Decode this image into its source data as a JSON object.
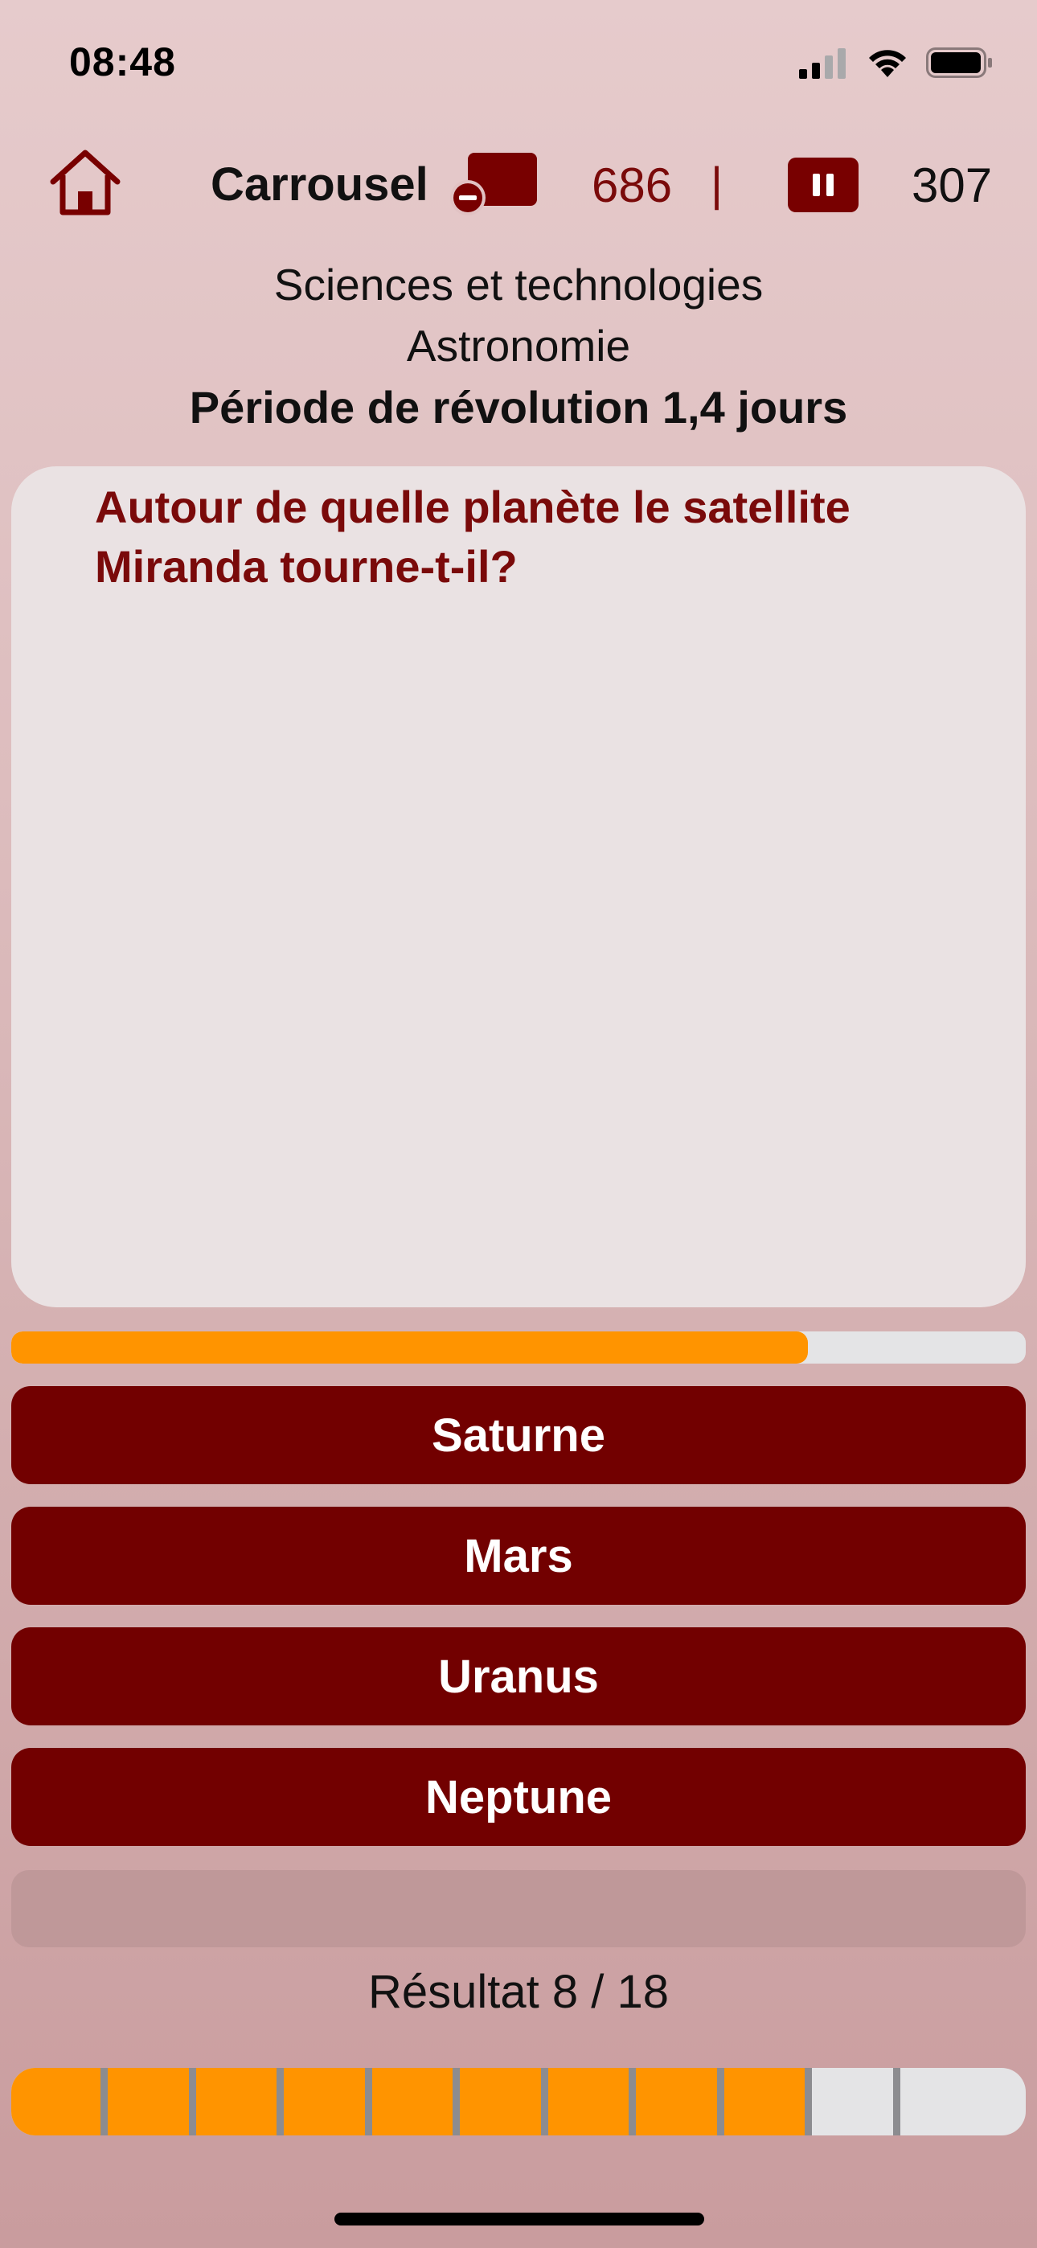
{
  "status_bar": {
    "time": "08:48",
    "icons": [
      "cellular-signal-icon",
      "wifi-icon",
      "battery-icon"
    ]
  },
  "header": {
    "home_icon": "home-icon",
    "mode_title": "Carrousel",
    "card_icon": "card-minus-icon",
    "score_left": "686",
    "separator": "|",
    "pause_icon": "pause-icon",
    "score_right": "307"
  },
  "category": {
    "domain": "Sciences et technologies",
    "subdomain": "Astronomie",
    "clue": "Période de révolution 1,4 jours"
  },
  "question": {
    "text": "Autour de quelle planète le satellite Miranda tourne-t-il?"
  },
  "timer": {
    "remaining_fraction": 0.785
  },
  "answers": [
    {
      "label": "Saturne"
    },
    {
      "label": "Mars"
    },
    {
      "label": "Uranus"
    },
    {
      "label": "Neptune"
    }
  ],
  "result": {
    "text": "Résultat 8 / 18",
    "segments_total": 11,
    "segments_filled": 8
  },
  "colors": {
    "accent": "#ff9400",
    "primary": "#720000",
    "question_text": "#7a0a0a",
    "card_background": "#eae2e3"
  }
}
